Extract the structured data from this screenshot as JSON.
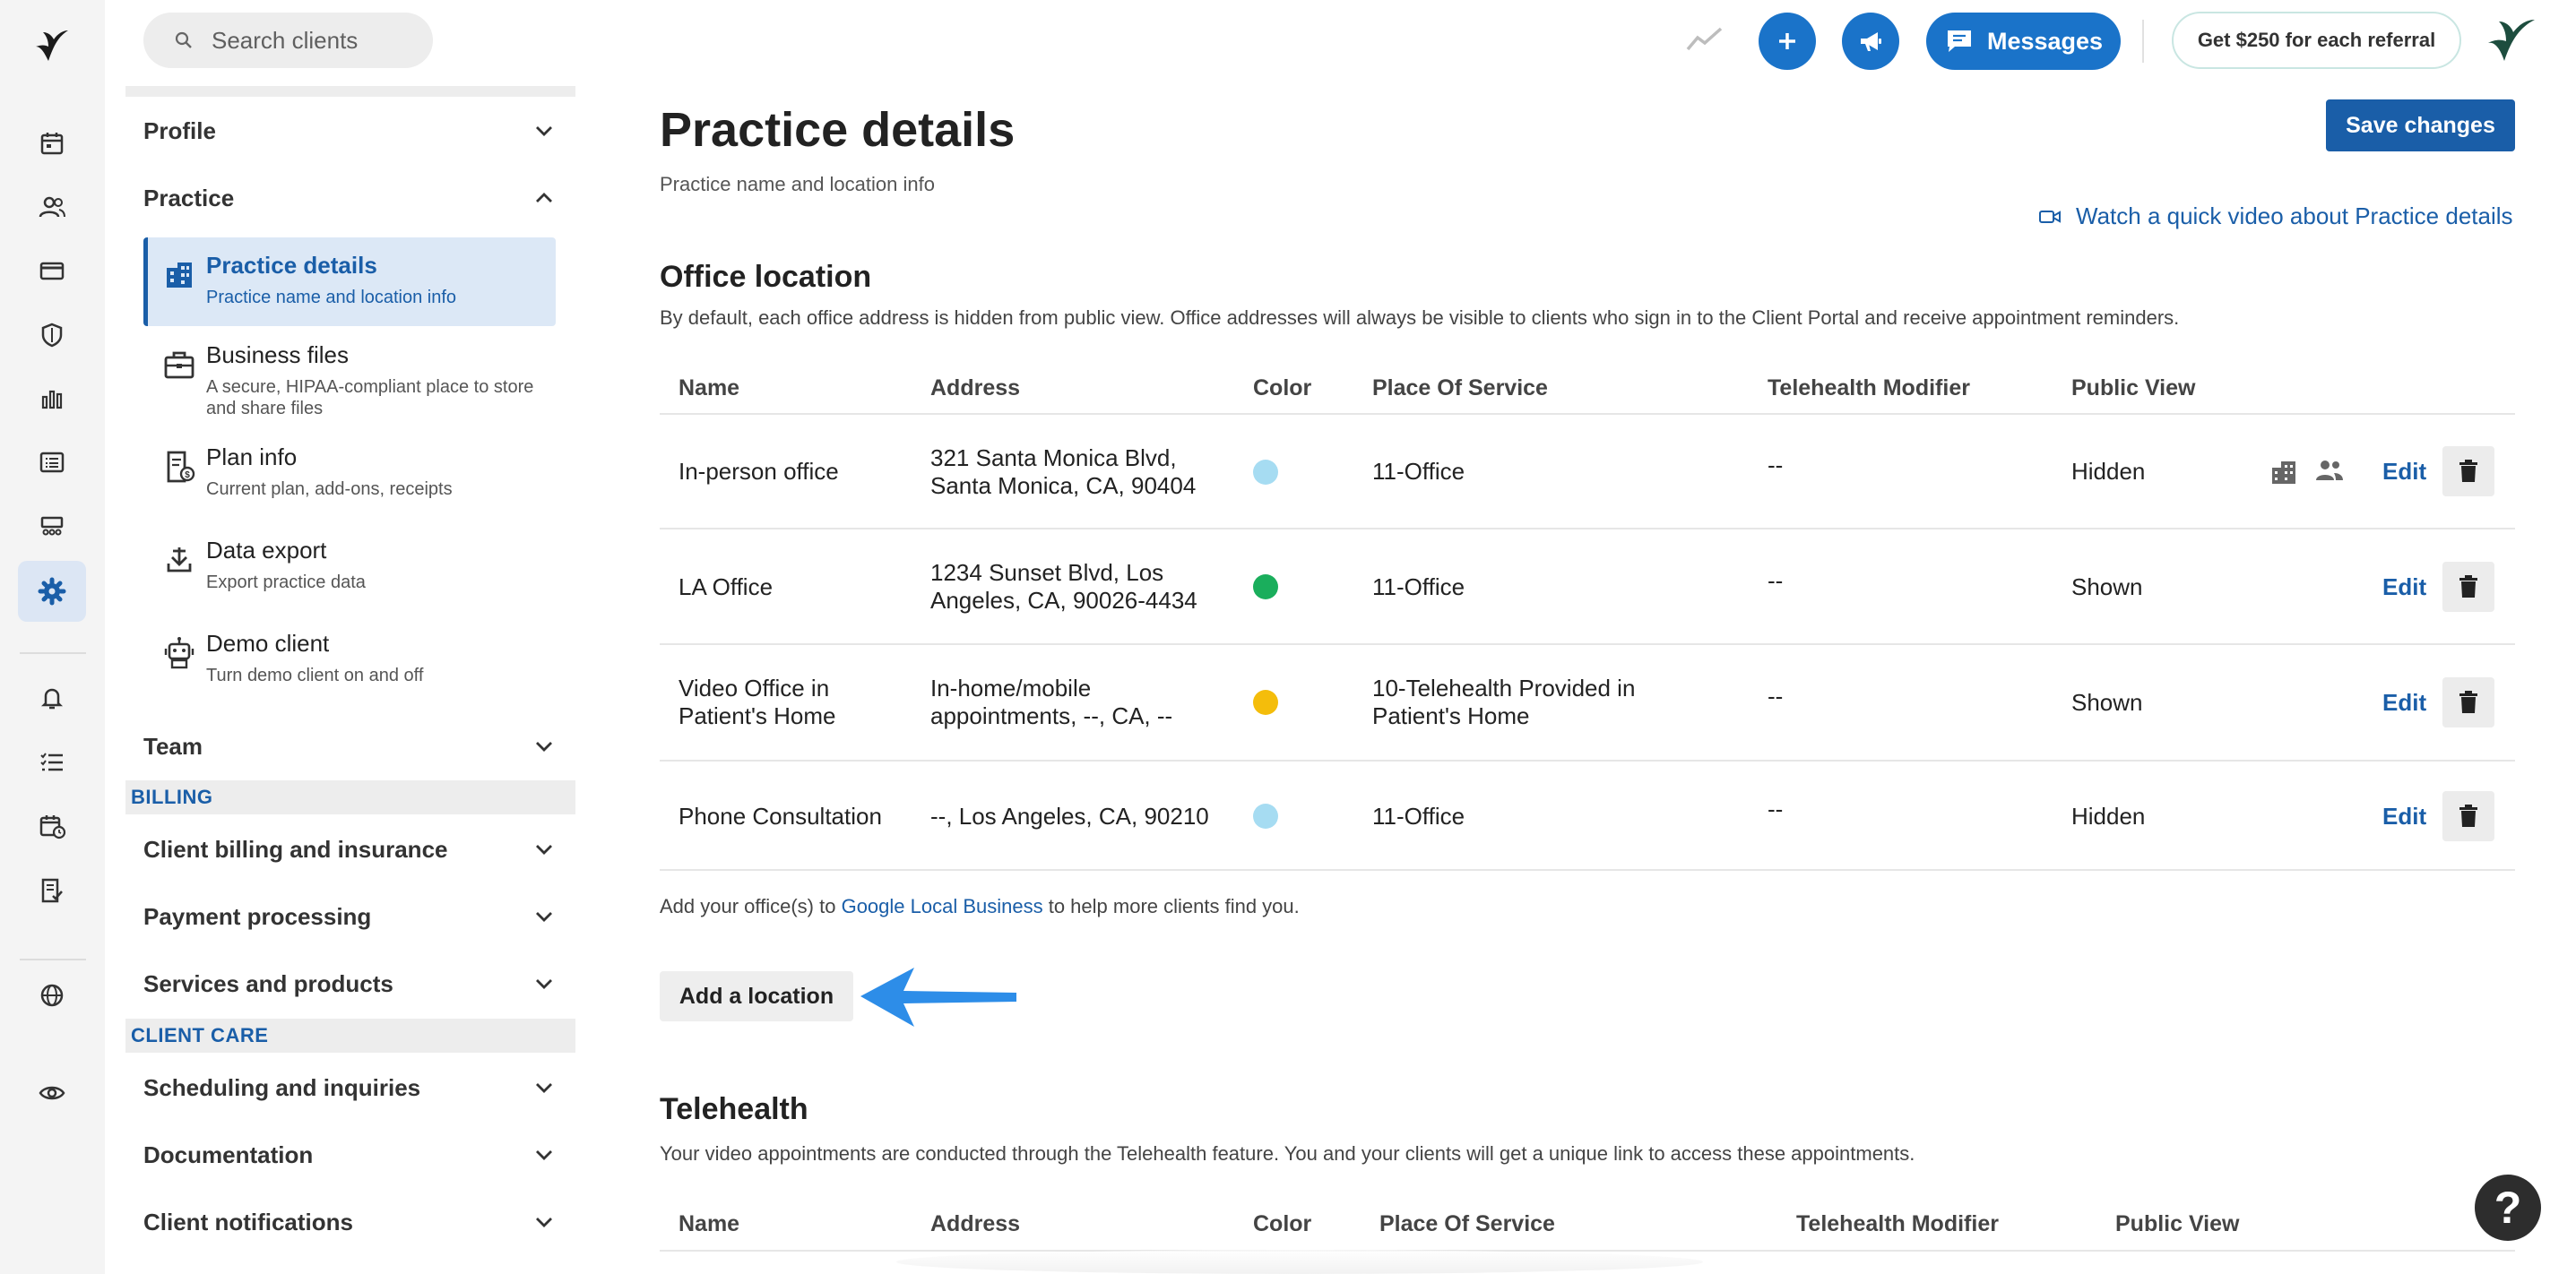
{
  "search": {
    "placeholder": "Search clients"
  },
  "topbar": {
    "messages_label": "Messages",
    "referral_label": "Get $250 for each referral",
    "accent_color": "#1a73c9"
  },
  "rail": {
    "icons": [
      "logo-icon",
      "calendar-icon",
      "clients-icon",
      "billing-card-icon",
      "insurance-shield-icon",
      "analytics-icon",
      "reports-icon",
      "marketing-icon",
      "settings-icon",
      "notifications-icon",
      "tasks-icon",
      "appointment-requests-icon",
      "documents-icon",
      "website-icon",
      "preview-icon"
    ]
  },
  "nav": {
    "profile": "Profile",
    "practice": "Practice",
    "practice_items": [
      {
        "title": "Practice details",
        "desc": "Practice name and location info"
      },
      {
        "title": "Business files",
        "desc": "A secure, HIPAA-compliant place to store and share files"
      },
      {
        "title": "Plan info",
        "desc": "Current plan, add-ons, receipts"
      },
      {
        "title": "Data export",
        "desc": "Export practice data"
      },
      {
        "title": "Demo client",
        "desc": "Turn demo client on and off"
      }
    ],
    "team": "Team",
    "billing_header": "BILLING",
    "billing_items": [
      "Client billing and insurance",
      "Payment processing",
      "Services and products"
    ],
    "client_care_header": "CLIENT CARE",
    "client_care_items": [
      "Scheduling and inquiries",
      "Documentation",
      "Client notifications"
    ]
  },
  "main": {
    "title": "Practice details",
    "subtitle": "Practice name and location info",
    "save_label": "Save changes",
    "video_link": "Watch a quick video about Practice details"
  },
  "office": {
    "title": "Office location",
    "desc": "By default, each office address is hidden from public view. Office addresses will always be visible to clients who sign in to the Client Portal and receive appointment reminders.",
    "columns": [
      "Name",
      "Address",
      "Color",
      "Place Of Service",
      "Telehealth Modifier",
      "Public View"
    ],
    "rows": [
      {
        "name": [
          "In-person office"
        ],
        "address": [
          "321 Santa Monica Blvd,",
          "Santa Monica, CA, 90404"
        ],
        "color": "#a6dcf2",
        "pos": [
          "11-Office"
        ],
        "modifier": "--",
        "public": "Hidden",
        "edit": "Edit"
      },
      {
        "name": [
          "LA Office"
        ],
        "address": [
          "1234 Sunset Blvd, Los",
          "Angeles, CA, 90026-4434"
        ],
        "color": "#1aae5c",
        "pos": [
          "11-Office"
        ],
        "modifier": "--",
        "public": "Shown",
        "edit": "Edit"
      },
      {
        "name": [
          "Video Office in",
          "Patient's Home"
        ],
        "address": [
          "In-home/mobile",
          "appointments, --, CA, --"
        ],
        "color": "#f4bd0b",
        "pos": [
          "10-Telehealth Provided in",
          "Patient's Home"
        ],
        "modifier": "--",
        "public": "Shown",
        "edit": "Edit"
      },
      {
        "name": [
          "Phone Consultation"
        ],
        "address": [
          "--, Los Angeles, CA, 90210"
        ],
        "color": "#a6dcf2",
        "pos": [
          "11-Office"
        ],
        "modifier": "--",
        "public": "Hidden",
        "edit": "Edit"
      }
    ],
    "google_pre": "Add your office(s) to ",
    "google_link": "Google Local Business",
    "google_post": " to help more clients find you.",
    "add_label": "Add a location"
  },
  "telehealth": {
    "title": "Telehealth",
    "desc": "Your video appointments are conducted through the Telehealth feature. You and your clients will get a unique link to access these appointments.",
    "columns": [
      "Name",
      "Address",
      "Color",
      "Place Of Service",
      "Telehealth Modifier",
      "Public View"
    ]
  },
  "help_label": "?"
}
